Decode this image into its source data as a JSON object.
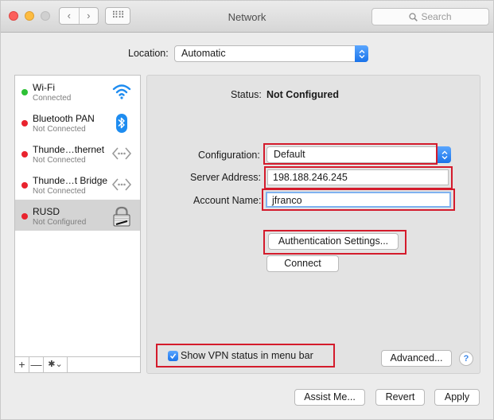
{
  "window": {
    "title": "Network"
  },
  "toolbar": {
    "back_glyph": "‹",
    "forward_glyph": "›",
    "grid_glyph": "⠿⠿",
    "search_placeholder": "Search"
  },
  "location": {
    "label": "Location:",
    "value": "Automatic"
  },
  "services": [
    {
      "name": "Wi-Fi",
      "status": "Connected",
      "status_color": "#2ec135",
      "icon": "wifi-icon"
    },
    {
      "name": "Bluetooth PAN",
      "status": "Not Connected",
      "status_color": "#e9232e",
      "icon": "bluetooth-icon"
    },
    {
      "name": "Thunde…thernet",
      "status": "Not Connected",
      "status_color": "#e9232e",
      "icon": "thunderbolt-ethernet-icon"
    },
    {
      "name": "Thunde…t Bridge",
      "status": "Not Connected",
      "status_color": "#e9232e",
      "icon": "thunderbolt-bridge-icon"
    },
    {
      "name": "RUSD",
      "status": "Not Configured",
      "status_color": "#e9232e",
      "icon": "vpn-lock-icon",
      "selected": true
    }
  ],
  "sidebar_tools": {
    "add": "+",
    "remove": "—",
    "action": "✱⌄"
  },
  "detail": {
    "status_label": "Status:",
    "status_value": "Not Configured",
    "configuration_label": "Configuration:",
    "configuration_value": "Default",
    "server_label": "Server Address:",
    "server_value": "198.188.246.245",
    "account_label": "Account Name:",
    "account_value": "jfranco",
    "auth_button": "Authentication Settings...",
    "connect_button": "Connect",
    "show_vpn_checkbox": "Show VPN status in menu bar",
    "show_vpn_checked": true,
    "advanced_button": "Advanced...",
    "help_glyph": "?"
  },
  "footer": {
    "assist_button": "Assist Me...",
    "revert_button": "Revert",
    "apply_button": "Apply"
  },
  "colors": {
    "accent": "#1a73ea",
    "highlight_box": "#d41b2c",
    "connected": "#2ec135",
    "disconnected": "#e9232e"
  }
}
